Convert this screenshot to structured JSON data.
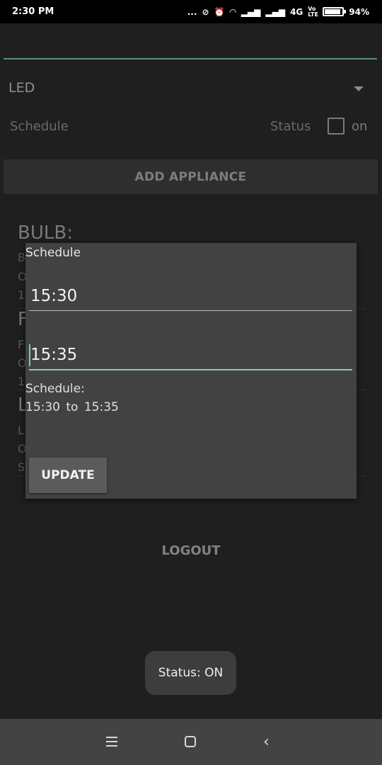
{
  "status_bar": {
    "time": "2:30 PM",
    "notif_dots": "...",
    "network": "4G",
    "volte": "Vo LTE",
    "battery": "94%"
  },
  "form": {
    "appliance_selected": "LED",
    "schedule_label": "Schedule",
    "status_label": "Status",
    "status_checkbox_checked": false,
    "on_label": "on",
    "add_button": "ADD APPLIANCE"
  },
  "list": {
    "items": [
      {
        "title": "BULB:",
        "fragments": [
          "B",
          "O",
          "1"
        ]
      },
      {
        "title": "F",
        "fragments": [
          "F",
          "O",
          "1"
        ]
      },
      {
        "title": "L",
        "fragments": [
          "L",
          "O",
          "S"
        ]
      }
    ]
  },
  "logout_button": "LOGOUT",
  "dialog": {
    "title": "Schedule",
    "start_time": "15:30",
    "end_time": "15:35",
    "summary_label": "Schedule:",
    "summary_value": "15:30  to  15:35",
    "update_button": "UPDATE"
  },
  "toast": "Status: ON",
  "colors": {
    "accent": "#80cbc4",
    "dialog_bg": "#424242",
    "app_bg": "#1f1f1f"
  }
}
